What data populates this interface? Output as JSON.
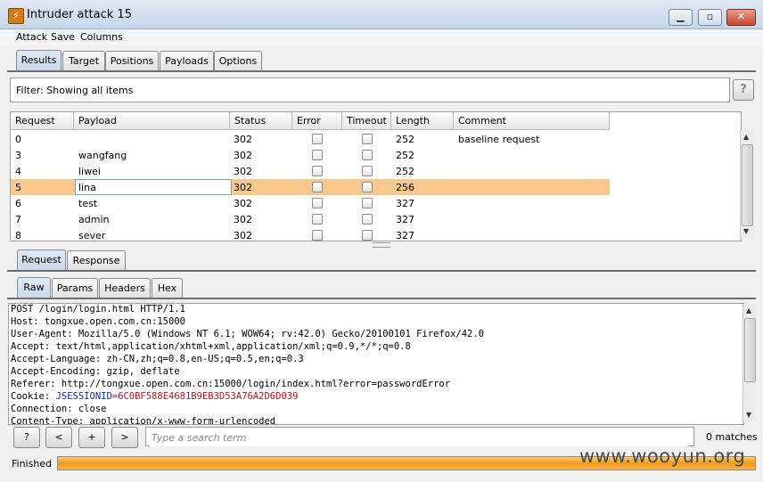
{
  "window": {
    "title": "Intruder attack 15",
    "minimize": "▁",
    "maximize": "▫",
    "close": "✕",
    "app_icon": "⚡"
  },
  "menu": [
    "Attack",
    "Save",
    "Columns"
  ],
  "main_tabs": [
    "Results",
    "Target",
    "Positions",
    "Payloads",
    "Options"
  ],
  "filter": {
    "label": "Filter: Showing all items",
    "help": "?"
  },
  "table": {
    "columns": [
      "Request",
      "Payload",
      "Status",
      "Error",
      "Timeout",
      "Length",
      "Comment"
    ],
    "rows": [
      {
        "request": "0",
        "payload": "",
        "status": "302",
        "length": "252",
        "comment": "baseline request"
      },
      {
        "request": "3",
        "payload": "wangfang",
        "status": "302",
        "length": "252",
        "comment": ""
      },
      {
        "request": "4",
        "payload": "liwei",
        "status": "302",
        "length": "252",
        "comment": ""
      },
      {
        "request": "5",
        "payload": "lina",
        "status": "302",
        "length": "256",
        "comment": ""
      },
      {
        "request": "6",
        "payload": "test",
        "status": "302",
        "length": "327",
        "comment": ""
      },
      {
        "request": "7",
        "payload": "admin",
        "status": "302",
        "length": "327",
        "comment": ""
      },
      {
        "request": "8",
        "payload": "sever",
        "status": "302",
        "length": "327",
        "comment": ""
      }
    ],
    "selected_request": "5"
  },
  "reqres_tabs": [
    "Request",
    "Response"
  ],
  "view_tabs": [
    "Raw",
    "Params",
    "Headers",
    "Hex"
  ],
  "editor": {
    "lines": [
      "POST /login/login.html HTTP/1.1",
      "Host: tongxue.open.com.cn:15000",
      "User-Agent: Mozilla/5.0 (Windows NT 6.1; WOW64; rv:42.0) Gecko/20100101 Firefox/42.0",
      "Accept: text/html,application/xhtml+xml,application/xml;q=0.9,*/*;q=0.8",
      "Accept-Language: zh-CN,zh;q=0.8,en-US;q=0.5,en;q=0.3",
      "Accept-Encoding: gzip, deflate",
      "Referer: http://tongxue.open.com.cn:15000/login/index.html?error=passwordError",
      "Connection: close",
      "Content-Type: application/x-www-form-urlencoded"
    ],
    "cookie_label": "Cookie: ",
    "cookie_name": "JSESSIONID",
    "cookie_value": "=6C0BF588E4681B9EB3D53A76A2D6D039"
  },
  "search": {
    "help": "?",
    "prev": "<",
    "add": "+",
    "next": ">",
    "placeholder": "Type a search term",
    "matches": "0 matches"
  },
  "status": {
    "text": "Finished",
    "progress": 1.0
  },
  "watermark": "www.wooyun.org"
}
